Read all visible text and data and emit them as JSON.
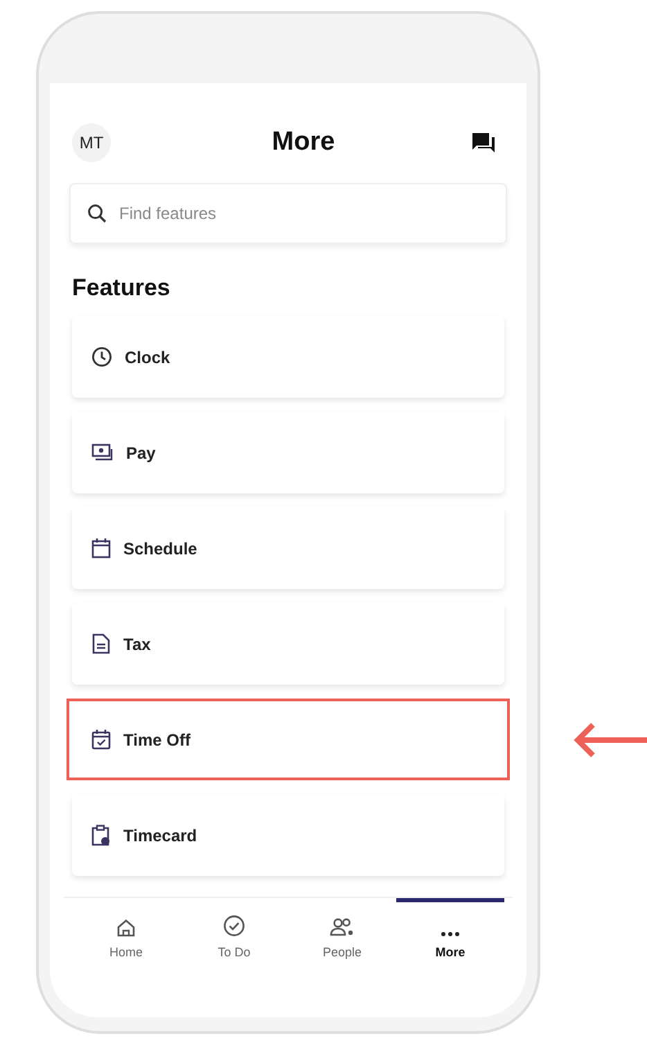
{
  "header": {
    "avatar": "MT",
    "title": "More"
  },
  "search": {
    "placeholder": "Find features"
  },
  "section_title": "Features",
  "features": [
    {
      "kind": "clock",
      "label": "Clock",
      "highlighted": false
    },
    {
      "kind": "pay",
      "label": "Pay",
      "highlighted": false
    },
    {
      "kind": "schedule",
      "label": "Schedule",
      "highlighted": false
    },
    {
      "kind": "tax",
      "label": "Tax",
      "highlighted": false
    },
    {
      "kind": "timeoff",
      "label": "Time Off",
      "highlighted": true
    },
    {
      "kind": "timecard",
      "label": "Timecard",
      "highlighted": false
    }
  ],
  "tab_bar": [
    {
      "kind": "home",
      "label": "Home",
      "selected": false
    },
    {
      "kind": "todo",
      "label": "To Do",
      "selected": false
    },
    {
      "kind": "people",
      "label": "People",
      "selected": false
    },
    {
      "kind": "more",
      "label": "More",
      "selected": true
    }
  ]
}
